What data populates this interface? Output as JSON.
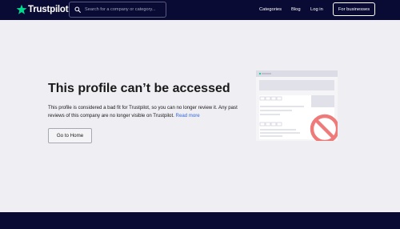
{
  "header": {
    "logo_text": "Trustpilot",
    "search_placeholder": "Search for a company or category...",
    "nav": {
      "categories": "Categories",
      "blog": "Blog",
      "login": "Log in",
      "for_businesses": "For businesses"
    }
  },
  "main": {
    "title": "This profile can’t be accessed",
    "description": "This profile is considered a bad fit for Trustpilot, so you can no longer review it. Any past reviews of this company are no longer visible on Trustpilot.",
    "read_more": "Read more",
    "home_button": "Go to Home"
  },
  "colors": {
    "header_bg": "#0a0b35",
    "page_bg": "#eeeef3",
    "brand_green": "#04da8d",
    "link_blue": "#3567d9",
    "forbidden_red": "#ee7a7a"
  },
  "icons": {
    "logo": "star-icon",
    "search": "search-icon",
    "illustration": "blocked-profile-illustration"
  }
}
